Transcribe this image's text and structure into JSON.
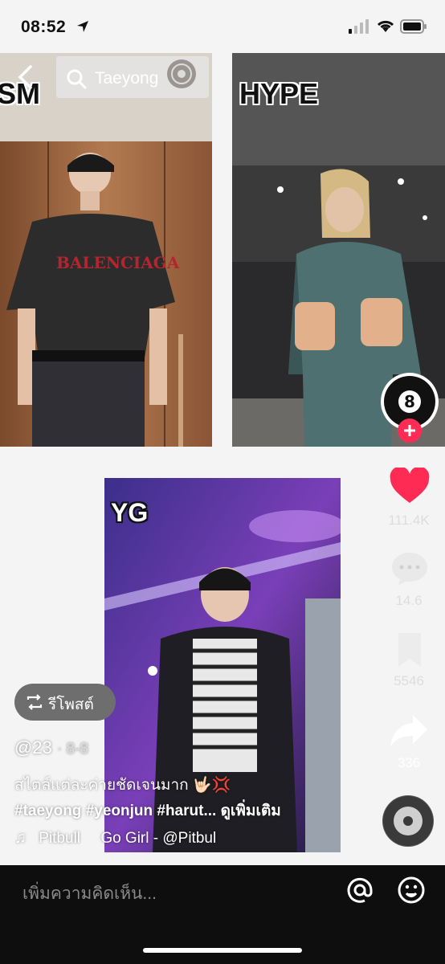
{
  "status_bar": {
    "time": "08:52"
  },
  "search": {
    "query": "Taeyong"
  },
  "panels": {
    "sm": {
      "label": "SM"
    },
    "hype": {
      "label": "HYPE"
    },
    "yg": {
      "label": "YG"
    }
  },
  "actions": {
    "likes": "111.4K",
    "comments": "14.6",
    "saves": "5546",
    "shares": "336"
  },
  "repost": {
    "label": "รีโพสต์"
  },
  "post": {
    "username": "@23",
    "date": "· 8-8",
    "caption": "สไตล์แต่ละค่ายชัดเจนมาก 🤟🏻💢",
    "hashtags": "#taeyong #yeonjun #harut...",
    "see_more": "ดูเพิ่มเติม",
    "music_artist": "Pitbull",
    "music_title": "Go Girl - @Pitbul"
  },
  "comment_bar": {
    "placeholder": "เพิ่มความคิดเห็น..."
  },
  "colors": {
    "like": "#fe2c55",
    "add": "#fe2c55"
  }
}
